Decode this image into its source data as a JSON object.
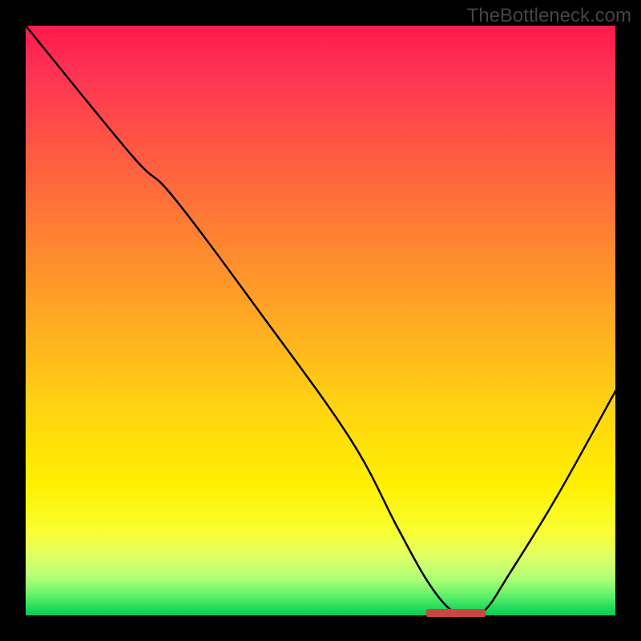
{
  "watermark": "TheBottleneck.com",
  "chart_data": {
    "type": "line",
    "title": "",
    "xlabel": "",
    "ylabel": "",
    "xlim": [
      0,
      100
    ],
    "ylim": [
      0,
      100
    ],
    "background_gradient": {
      "top": "#ff1a4d",
      "bottom": "#00cc55",
      "meaning": "red high bottleneck, green low bottleneck"
    },
    "series": [
      {
        "name": "bottleneck-curve",
        "x": [
          0,
          18,
          25,
          40,
          55,
          63,
          68,
          72,
          75,
          78,
          82,
          90,
          100
        ],
        "y": [
          100,
          78,
          71,
          51,
          30,
          15,
          6,
          1,
          0,
          1,
          7,
          20,
          38
        ]
      }
    ],
    "optimal_marker": {
      "x_start": 68,
      "x_end": 78,
      "y": 0,
      "color": "#cc4444"
    }
  }
}
